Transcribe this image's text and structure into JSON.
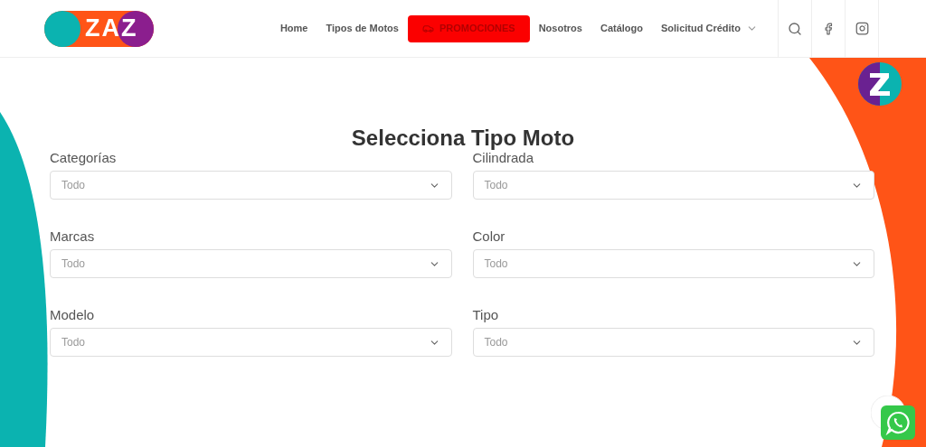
{
  "logo": {
    "text": "ZAZ"
  },
  "nav": [
    {
      "label": "Home",
      "kind": "link"
    },
    {
      "label": "Tipos de Motos",
      "kind": "link"
    },
    {
      "label": "PROMOCIONES",
      "kind": "promo"
    },
    {
      "label": "Nosotros",
      "kind": "link"
    },
    {
      "label": "Catálogo",
      "kind": "link"
    },
    {
      "label": "Solicitud Crédito",
      "kind": "dropdown"
    }
  ],
  "title": "Selecciona Tipo Moto",
  "filters": [
    {
      "label": "Categorías",
      "value": "Todo"
    },
    {
      "label": "Cilindrada",
      "value": "Todo"
    },
    {
      "label": "Marcas",
      "value": "Todo"
    },
    {
      "label": "Color",
      "value": "Todo"
    },
    {
      "label": "Modelo",
      "value": "Todo"
    },
    {
      "label": "Tipo",
      "value": "Todo"
    }
  ]
}
